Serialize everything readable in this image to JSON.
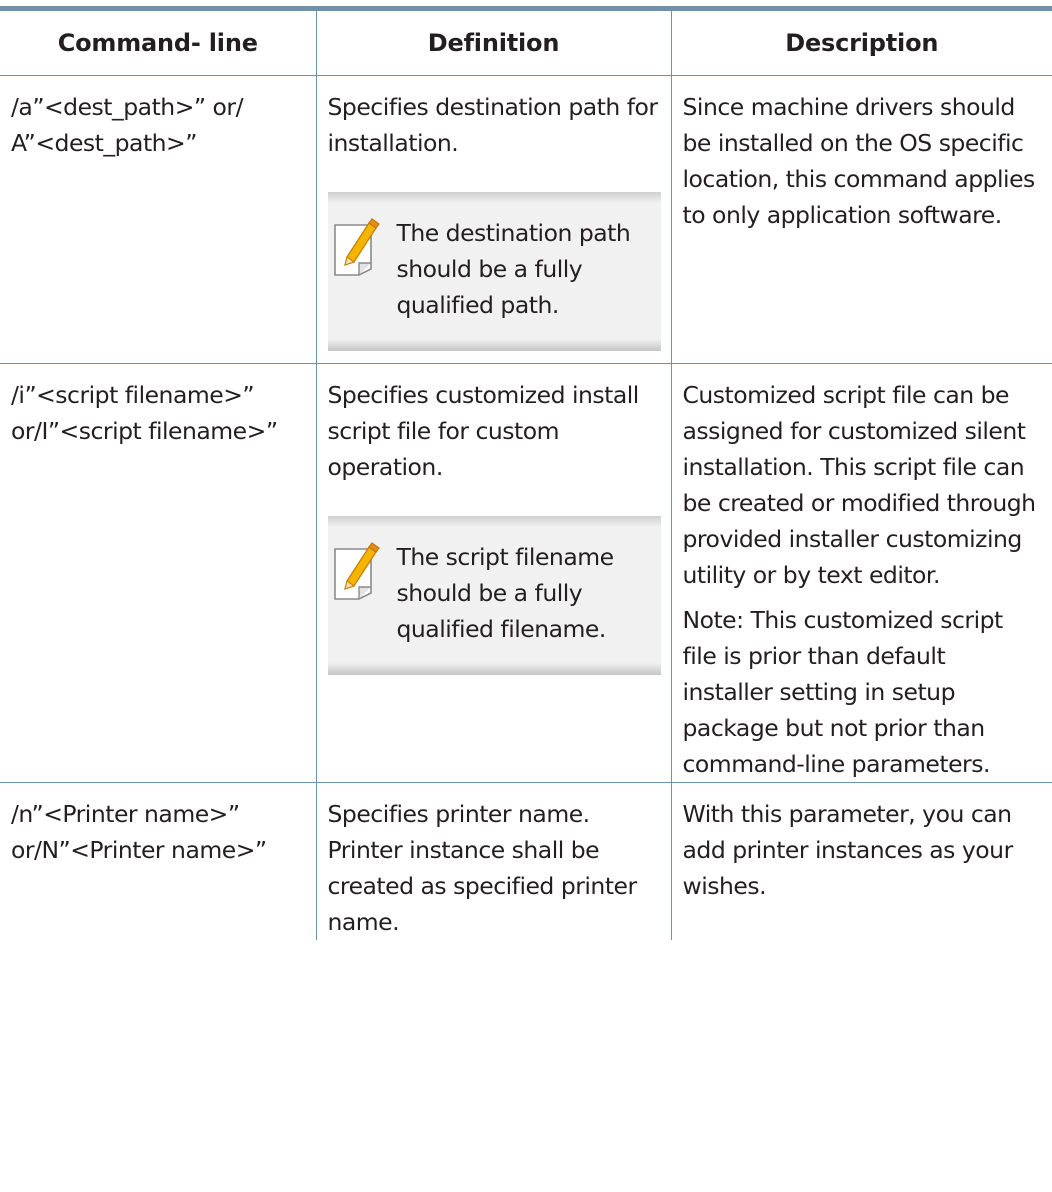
{
  "table": {
    "headers": [
      "Command- line",
      "Definition",
      "Description"
    ],
    "rows": [
      {
        "command": "/a”<dest_path>” or/ A”<dest_path>”",
        "definition": "Specifies destination path for installation.",
        "note": "The destination path should be a fully qualified path.",
        "description": [
          "Since machine drivers should be installed on the OS specific location, this command applies to only application software."
        ]
      },
      {
        "command": "/i”<script filename>” or/I”<script filename>”",
        "definition": "Specifies customized install script file for custom operation.",
        "note": "The script filename should be a fully qualified filename.",
        "description": [
          "Customized script file can be assigned for customized silent installation. This script file can be created or modified through provided installer customizing utility or by text editor.",
          "Note: This customized script file is prior than default installer setting in setup package but not prior than command-line parameters."
        ]
      },
      {
        "command": "/n”<Printer name>” or/N”<Printer name>”",
        "definition": "Specifies printer name. Printer instance shall be created as specified printer name.",
        "note": null,
        "description": [
          "With this parameter, you can add printer instances as your wishes."
        ]
      }
    ]
  },
  "icons": {
    "note": "pencil-note-icon"
  },
  "colors": {
    "rule": "#6e91ad",
    "text": "#231f20",
    "note_bg": "#f1f1f1",
    "icon_pencil": "#f5b400"
  }
}
